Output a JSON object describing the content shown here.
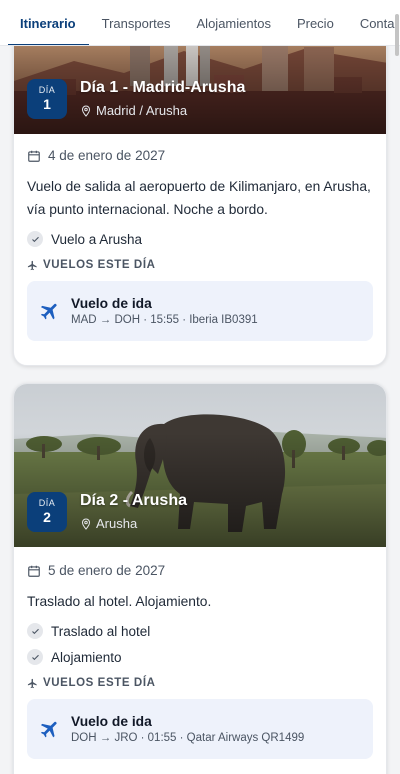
{
  "tabs": [
    "Itinerario",
    "Transportes",
    "Alojamientos",
    "Precio",
    "Conta"
  ],
  "days": [
    {
      "badge_label": "DÍA",
      "badge_num": "1",
      "title": "Día 1 - Madrid-Arusha",
      "location": "Madrid / Arusha",
      "date": "4 de enero de 2027",
      "description": "Vuelo de salida al aeropuerto de Kilimanjaro, en Arusha, vía punto internacional. Noche a bordo.",
      "items": [
        "Vuelo a Arusha"
      ],
      "flights_heading": "VUELOS ESTE DÍA",
      "flight": {
        "title": "Vuelo de ida",
        "details": "MAD → DOH · 15:55 · Iberia IB0391"
      }
    },
    {
      "badge_label": "DÍA",
      "badge_num": "2",
      "title": "Día 2 - Arusha",
      "location": "Arusha",
      "date": "5 de enero de 2027",
      "description": "Traslado al hotel. Alojamiento.",
      "items": [
        "Traslado al hotel",
        "Alojamiento"
      ],
      "flights_heading": "VUELOS ESTE DÍA",
      "flight": {
        "title": "Vuelo de ida",
        "details": "DOH → JRO · 01:55 · Qatar Airways QR1499"
      }
    }
  ],
  "colors": {
    "accent": "#0b3f7a",
    "flight_bg": "#eef2fb"
  }
}
